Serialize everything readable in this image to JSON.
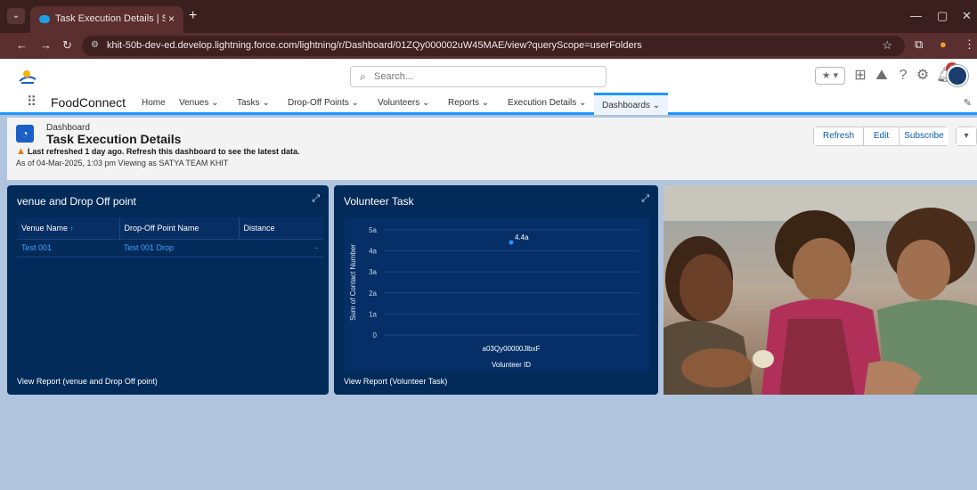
{
  "browser": {
    "tab_title": "Task Execution Details | Salesfor",
    "tab_close": "×",
    "new_tab": "+",
    "url": "khit-50b-dev-ed.develop.lightning.force.com/lightning/r/Dashboard/01ZQy000002uW45MAE/view?queryScope=userFolders",
    "win_min": "—",
    "win_max": "▢",
    "win_close": "✕"
  },
  "header": {
    "search_placeholder": "Search...",
    "notification_count": "2",
    "help": "?"
  },
  "nav": {
    "app_name": "FoodConnect",
    "items": [
      {
        "label": "Home"
      },
      {
        "label": "Venues ⌄"
      },
      {
        "label": "Tasks ⌄"
      },
      {
        "label": "Drop-Off Points ⌄"
      },
      {
        "label": "Volunteers ⌄"
      },
      {
        "label": "Reports ⌄"
      },
      {
        "label": "Execution Details ⌄"
      },
      {
        "label": "Dashboards ⌄"
      }
    ]
  },
  "dashboard": {
    "breadcrumb": "Dashboard",
    "title": "Task Execution Details",
    "warning": "Last refreshed 1 day ago. Refresh this dashboard to see the latest data.",
    "as_of": "As of 04-Mar-2025, 1:03 pm Viewing as SATYA TEAM KHIT",
    "buttons": {
      "refresh": "Refresh",
      "edit": "Edit",
      "subscribe": "Subscribe",
      "more": "▾"
    }
  },
  "widget_table": {
    "title": "venue and Drop Off point",
    "columns": [
      "Venue Name",
      "Drop-Off Point Name",
      "Distance"
    ],
    "sort_indicator": "↑",
    "rows": [
      {
        "venue": "Test 001",
        "dropoff": "Test 001 Drop",
        "distance": "-"
      }
    ],
    "footer": "View Report (venue and Drop Off point)"
  },
  "widget_chart": {
    "title": "Volunteer Task",
    "footer": "View Report (Volunteer Task)"
  },
  "chart_data": {
    "type": "scatter",
    "categories": [
      "a03Qy00000JlbxF"
    ],
    "values": [
      4.4
    ],
    "data_labels": [
      "4.4a"
    ],
    "xlabel": "Volunteer ID",
    "ylabel": "Sum of Contact Number",
    "y_ticks": [
      "0",
      "1a",
      "2a",
      "3a",
      "4a",
      "5a"
    ],
    "ylim": [
      0,
      5
    ],
    "grid": true,
    "color": "#1b96ff"
  },
  "colors": {
    "panel": "#032b5a",
    "accent": "#1b96ff",
    "link": "#3fa2ff"
  },
  "icons": {
    "expand": "expand-icon",
    "warning": "warning-icon"
  }
}
